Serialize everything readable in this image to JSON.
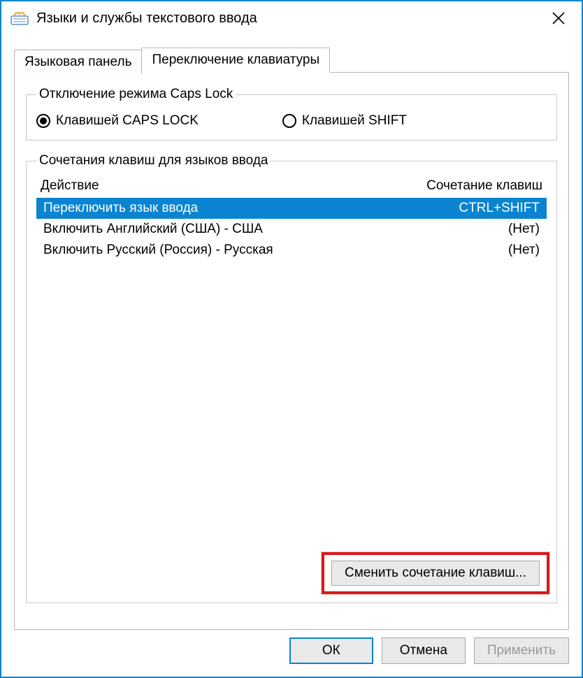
{
  "window": {
    "title": "Языки и службы текстового ввода"
  },
  "tabs": {
    "language_bar": "Языковая панель",
    "keyboard_switch": "Переключение клавиатуры"
  },
  "capslock": {
    "legend": "Отключение режима Caps Lock",
    "opt_caps": "Клавишей CAPS LOCK",
    "opt_shift": "Клавишей SHIFT"
  },
  "hotkeys": {
    "legend": "Сочетания клавиш для языков ввода",
    "col_action": "Действие",
    "col_combo": "Сочетание клавиш",
    "rows": [
      {
        "action": "Переключить язык ввода",
        "combo": "CTRL+SHIFT",
        "selected": true
      },
      {
        "action": "Включить Английский (США) - США",
        "combo": "(Нет)",
        "selected": false
      },
      {
        "action": "Включить Русский (Россия) - Русская",
        "combo": "(Нет)",
        "selected": false
      }
    ],
    "change_button": "Сменить сочетание клавиш..."
  },
  "footer": {
    "ok": "ОК",
    "cancel": "Отмена",
    "apply": "Применить"
  }
}
